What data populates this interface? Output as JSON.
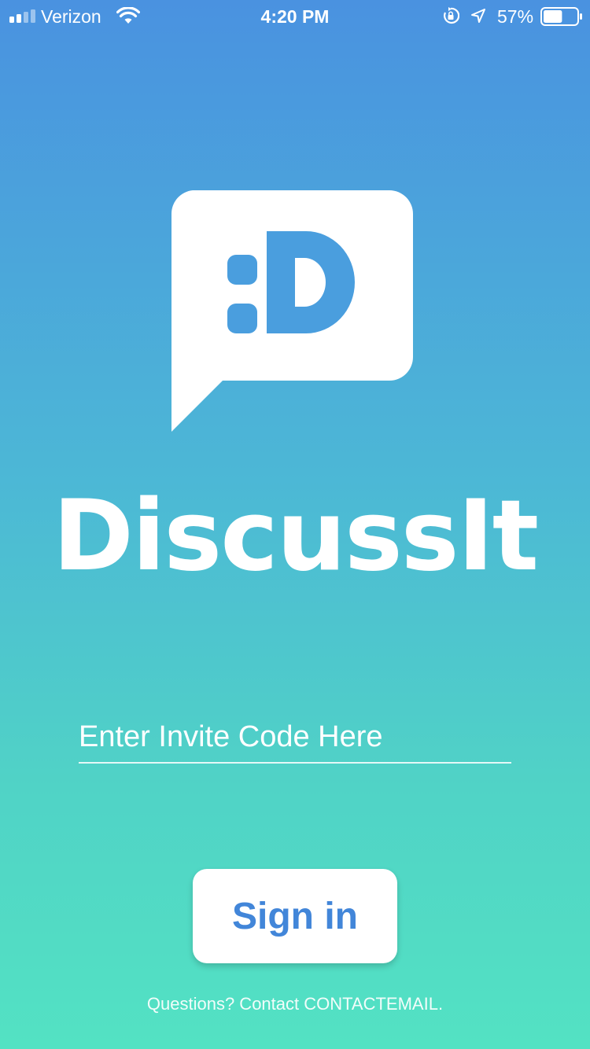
{
  "status_bar": {
    "carrier": "Verizon",
    "signal_bars": 4,
    "signal_active_bars": 2,
    "time": "4:20 PM",
    "battery_percent": "57%",
    "battery_level": 0.57,
    "icons": [
      "signal-icon",
      "wifi-icon",
      "rotation-lock-icon",
      "location-arrow-icon",
      "battery-icon"
    ]
  },
  "logo": {
    "icon": "speech-bubble-emoticon-icon",
    "emoticon_text": ":D"
  },
  "app": {
    "name": "DiscussIt"
  },
  "invite": {
    "placeholder": "Enter Invite Code Here",
    "value": ""
  },
  "actions": {
    "sign_in_label": "Sign in"
  },
  "footer": {
    "text": "Questions? Contact CONTACTEMAIL."
  },
  "colors": {
    "gradient_top": "#4a92e0",
    "gradient_bottom": "#53e2c3",
    "accent": "#4286d9",
    "logo_glyph": "#4a9ede"
  }
}
